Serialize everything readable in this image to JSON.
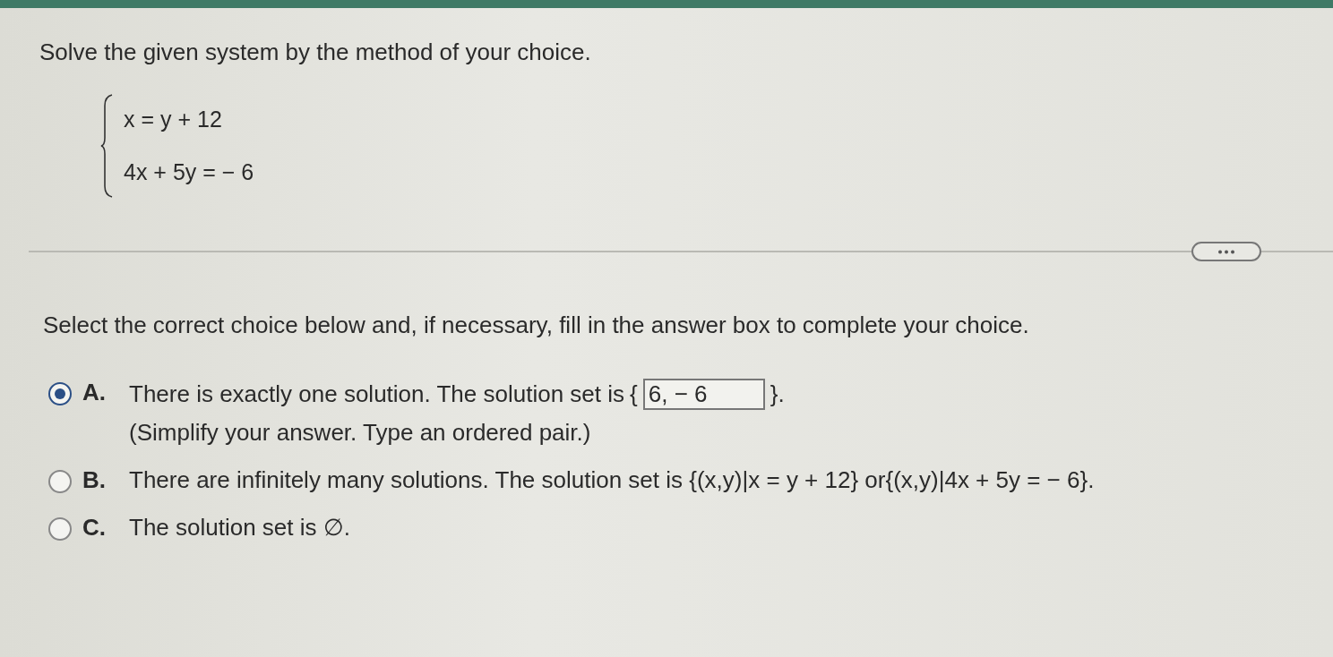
{
  "question": {
    "prompt": "Solve the given system by the method of your choice.",
    "equations": [
      "x = y + 12",
      "4x + 5y =  − 6"
    ]
  },
  "instruction": "Select the correct choice below and, if necessary, fill in the answer box to complete your choice.",
  "choices": [
    {
      "letter": "A.",
      "selected": true,
      "kind": "answer",
      "text": "There is exactly one solution. The solution set is",
      "open": "{",
      "value": "6, − 6",
      "close": "}.",
      "hint": "(Simplify your answer. Type an ordered pair.)"
    },
    {
      "letter": "B.",
      "selected": false,
      "kind": "plain",
      "text": "There are infinitely many solutions. The solution set is {(x,y)|x = y + 12} or{(x,y)|4x + 5y =  − 6}."
    },
    {
      "letter": "C.",
      "selected": false,
      "kind": "plain",
      "text": "The solution set is ∅."
    }
  ]
}
